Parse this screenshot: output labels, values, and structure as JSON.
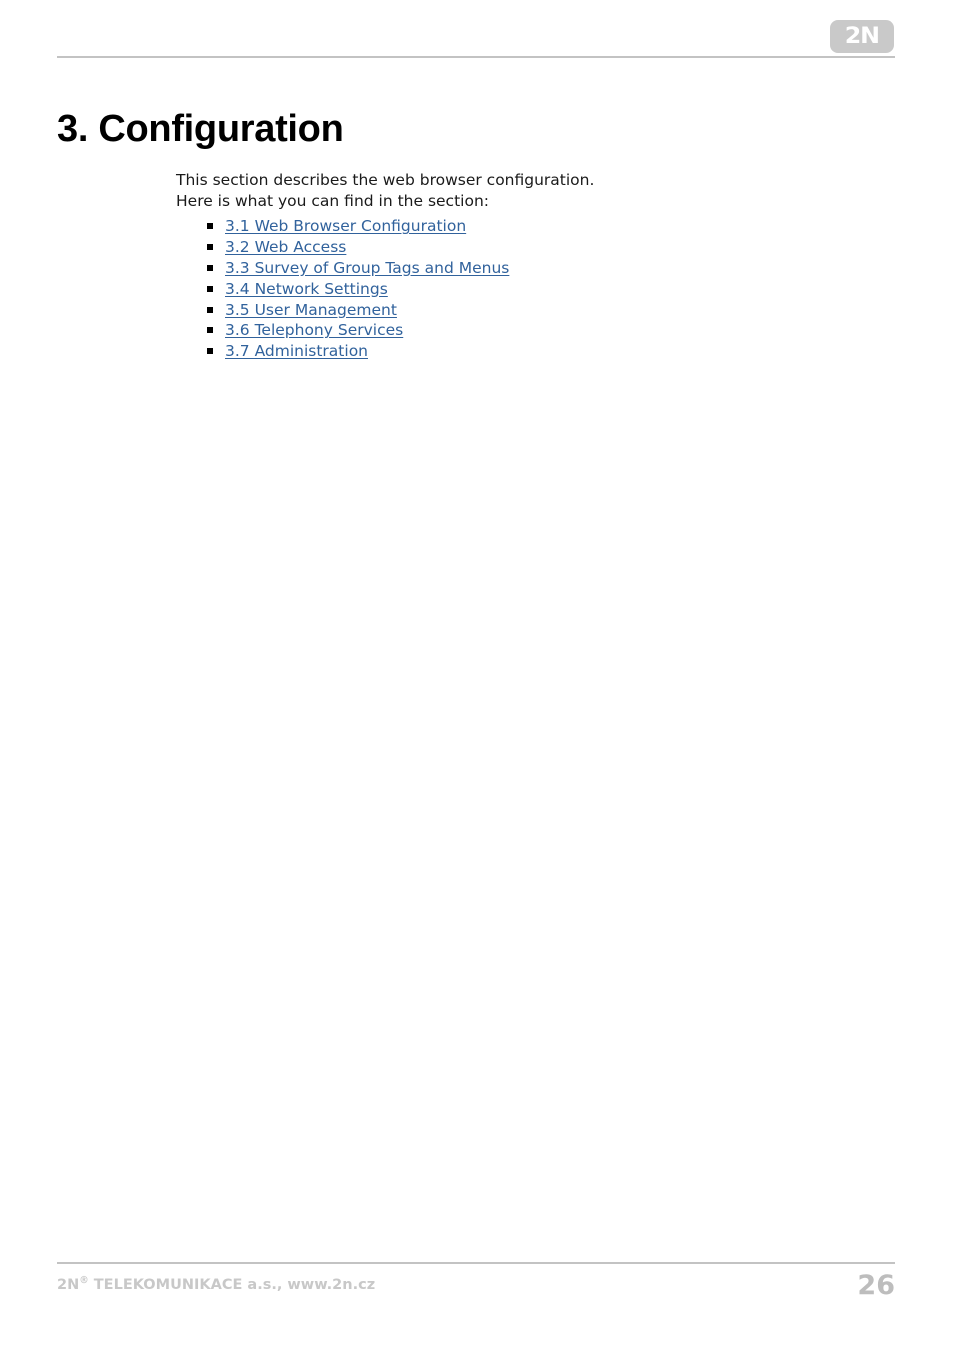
{
  "header": {
    "logo_text": "2N",
    "logo_color": "#c9c9c9",
    "rule_color": "#c3c3c3"
  },
  "document": {
    "title": "3. Configuration",
    "intro_line_1": "This section describes the web browser configuration.",
    "intro_line_2": "Here is what you can find in the section:",
    "link_color": "#31629c",
    "toc": [
      {
        "label": "3.1 Web Browser Configuration"
      },
      {
        "label": "3.2 Web Access"
      },
      {
        "label": "3.3 Survey of Group Tags and Menus"
      },
      {
        "label": "3.4 Network Settings"
      },
      {
        "label": "3.5 User Management"
      },
      {
        "label": "3.6 Telephony Services"
      },
      {
        "label": "3.7 Administration"
      }
    ]
  },
  "footer": {
    "company_prefix": "2N",
    "company_mark": "®",
    "company_suffix": " TELEKOMUNIKACE a.s., www.2n.cz",
    "page_number": "26",
    "text_color": "#c8c8c8"
  }
}
